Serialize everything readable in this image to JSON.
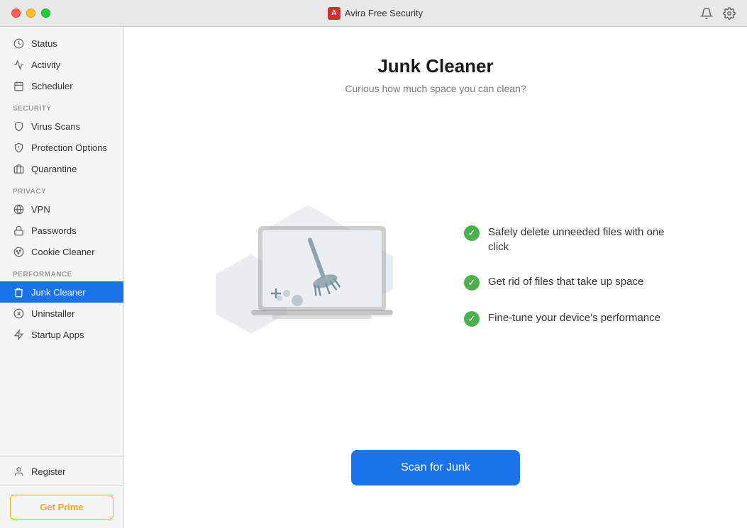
{
  "titlebar": {
    "app_name": "Avira Free Security",
    "avira_abbr": "A",
    "traffic_lights": [
      "close",
      "minimize",
      "maximize"
    ]
  },
  "sidebar": {
    "items_top": [
      {
        "id": "status",
        "label": "Status",
        "icon": "circle-check"
      },
      {
        "id": "activity",
        "label": "Activity",
        "icon": "bar-chart"
      },
      {
        "id": "scheduler",
        "label": "Scheduler",
        "icon": "calendar"
      }
    ],
    "section_security": "SECURITY",
    "items_security": [
      {
        "id": "virus-scans",
        "label": "Virus Scans",
        "icon": "shield-scan"
      },
      {
        "id": "protection-options",
        "label": "Protection Options",
        "icon": "shield"
      },
      {
        "id": "quarantine",
        "label": "Quarantine",
        "icon": "box"
      }
    ],
    "section_privacy": "PRIVACY",
    "items_privacy": [
      {
        "id": "vpn",
        "label": "VPN",
        "icon": "vpn"
      },
      {
        "id": "passwords",
        "label": "Passwords",
        "icon": "lock"
      },
      {
        "id": "cookie-cleaner",
        "label": "Cookie Cleaner",
        "icon": "cookie"
      }
    ],
    "section_performance": "PERFORMANCE",
    "items_performance": [
      {
        "id": "junk-cleaner",
        "label": "Junk Cleaner",
        "icon": "broom",
        "active": true
      },
      {
        "id": "uninstaller",
        "label": "Uninstaller",
        "icon": "uninstall"
      },
      {
        "id": "startup-apps",
        "label": "Startup Apps",
        "icon": "rocket"
      }
    ],
    "get_prime_label": "Get Prime",
    "register_label": "Register"
  },
  "main": {
    "title": "Junk Cleaner",
    "subtitle": "Curious how much space you can clean?",
    "features": [
      {
        "text": "Safely delete unneeded files with one click"
      },
      {
        "text": "Get rid of files that take up space"
      },
      {
        "text": "Fine-tune your device's performance"
      }
    ],
    "scan_button_label": "Scan for Junk"
  }
}
